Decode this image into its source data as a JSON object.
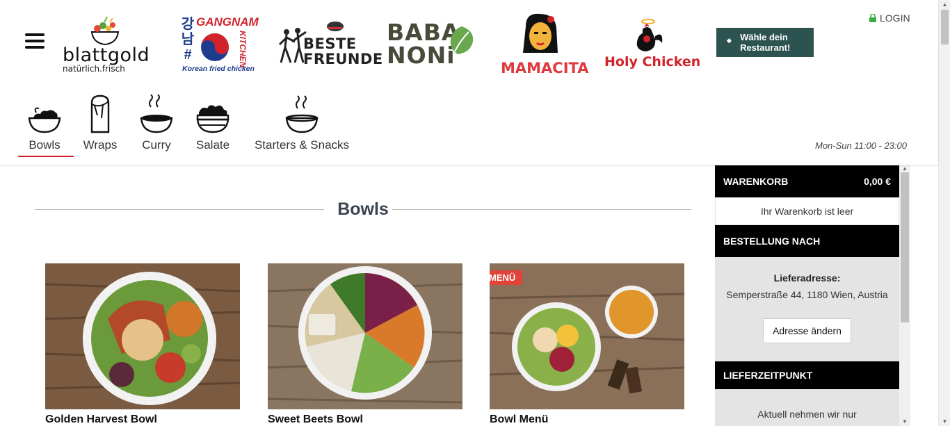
{
  "header": {
    "menu_icon": "hamburger-menu-icon",
    "brands": {
      "blattgold": {
        "name": "blattgold",
        "tagline": "natürlich.frisch"
      },
      "gangnam": {
        "title": "GANGNAM",
        "side": "강남#",
        "kitchen": "KITCHEN",
        "tagline": "Korean fried chicken"
      },
      "beste": {
        "line1": "BESTE",
        "line2": "FREUNDE"
      },
      "baba": {
        "line1": "BABA",
        "line2": "NONi"
      },
      "mamacita": {
        "name": "MAMACITA"
      },
      "holy": {
        "name": "Holy Chicken"
      }
    },
    "choose_button": {
      "line1": "Wähle dein",
      "line2": "Restaurant!"
    },
    "login_label": "LOGIN",
    "categories": [
      {
        "label": "Bowls",
        "icon": "bowl-salad-icon",
        "active": true
      },
      {
        "label": "Wraps",
        "icon": "wrap-icon",
        "active": false
      },
      {
        "label": "Curry",
        "icon": "curry-bowl-icon",
        "active": false
      },
      {
        "label": "Salate",
        "icon": "salad-bowl-icon",
        "active": false
      },
      {
        "label": "Starters & Snacks",
        "icon": "soup-bowl-icon",
        "active": false
      }
    ],
    "hours": "Mon-Sun 11:00 - 23:00"
  },
  "main": {
    "section_title": "Bowls",
    "products": [
      {
        "name": "Golden Harvest Bowl",
        "badge": ""
      },
      {
        "name": "Sweet Beets Bowl",
        "badge": ""
      },
      {
        "name": "Bowl Menü",
        "badge": "MENÜ"
      }
    ]
  },
  "cart": {
    "title": "WARENKORB",
    "total": "0,00 €",
    "empty_text": "Ihr Warenkorb ist leer",
    "order_header": "BESTELLUNG NACH",
    "address_label": "Lieferadresse:",
    "address": "Semperstraße 44, 1180 Wien, Austria",
    "change_button": "Adresse ändern",
    "time_header": "LIEFERZEITPUNKT",
    "time_note": "Aktuell nehmen wir nur"
  },
  "colors": {
    "accent_green": "#2c5350",
    "brand_red": "#d2232a",
    "badge_red": "#e0433a"
  }
}
